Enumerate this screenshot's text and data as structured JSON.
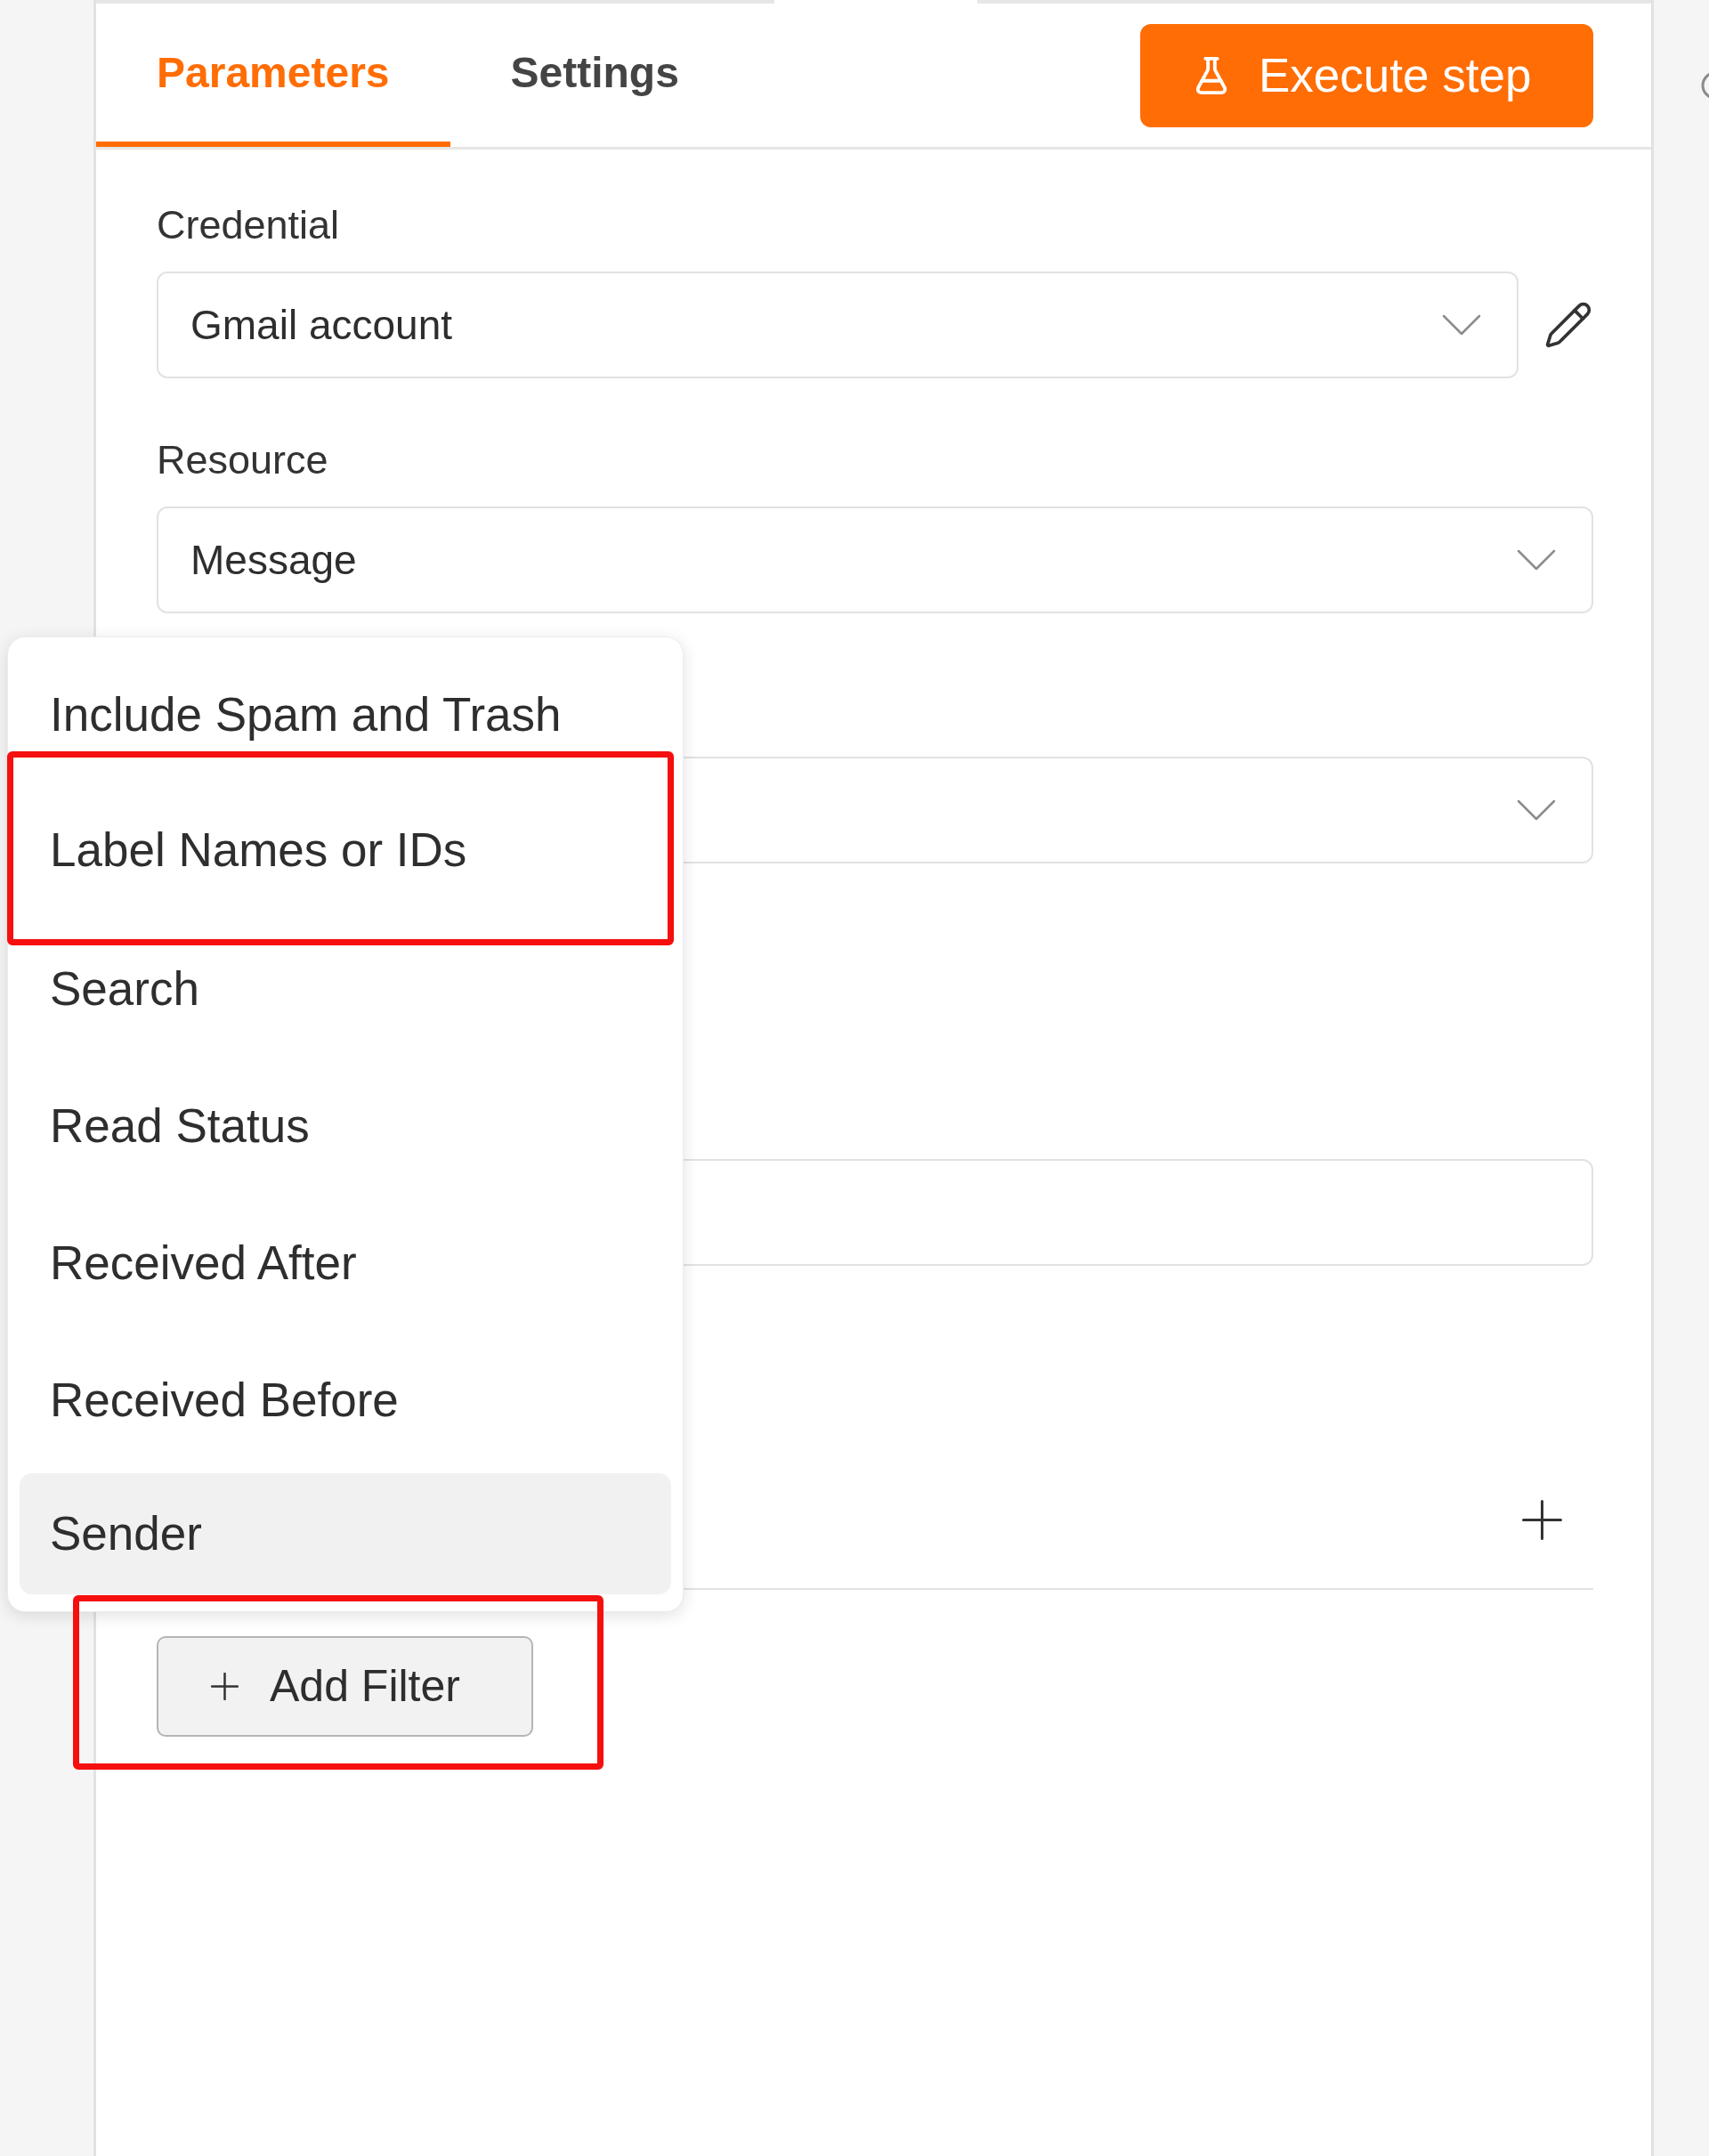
{
  "tabs": [
    {
      "label": "Parameters",
      "selected": true
    },
    {
      "label": "Settings",
      "selected": false
    }
  ],
  "execute_button": {
    "label": "Execute step"
  },
  "fields": [
    {
      "kind": "select",
      "label": "Credential",
      "value": "Gmail account",
      "editable": true
    },
    {
      "kind": "select",
      "label": "Resource",
      "value": "Message"
    },
    {
      "kind": "select"
    },
    {
      "kind": "input"
    }
  ],
  "filters": {
    "add_button": {
      "label": "Add Filter",
      "framed": true
    }
  },
  "dropdown_menu": {
    "items": [
      {
        "label": "Include Spam and Trash",
        "highlighted": false,
        "framed": false
      },
      {
        "label": "Label Names or IDs",
        "highlighted": false,
        "framed": true
      },
      {
        "label": "Search",
        "highlighted": false,
        "framed": false
      },
      {
        "label": "Read Status",
        "highlighted": false,
        "framed": false
      },
      {
        "label": "Received After",
        "highlighted": false,
        "framed": false
      },
      {
        "label": "Received Before",
        "highlighted": false,
        "framed": false
      },
      {
        "label": "Sender",
        "highlighted": true,
        "framed": false
      }
    ]
  }
}
